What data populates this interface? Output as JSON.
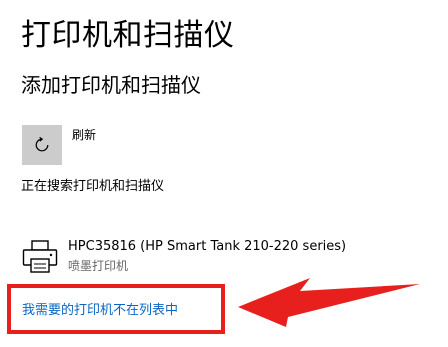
{
  "page": {
    "title": "打印机和扫描仪"
  },
  "add_section": {
    "heading": "添加打印机和扫描仪",
    "refresh_label": "刷新",
    "refresh_icon": "refresh-icon",
    "searching_text": "正在搜索打印机和扫描仪"
  },
  "devices": [
    {
      "name": "HPC35816 (HP Smart Tank 210-220 series)",
      "type": "喷墨打印机",
      "icon": "printer-icon"
    }
  ],
  "missing_printer_link": "我需要的打印机不在列表中",
  "colors": {
    "link": "#0a66c2",
    "annotation_red": "#e8201d",
    "refresh_button_bg": "#cccccc",
    "secondary_text": "#666666"
  }
}
